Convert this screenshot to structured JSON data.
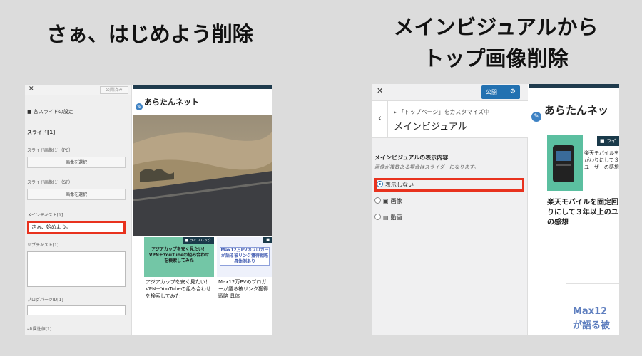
{
  "headings": {
    "left": "さぁ、はじめよう削除",
    "right_line1": "メインビジュアルから",
    "right_line2": "トップ画像削除"
  },
  "left_panel": {
    "close": "✕",
    "published": "公開済み",
    "section_title": "■ 各スライドの設定",
    "slide_heading": "スライド[1]",
    "image_pc_label": "スライド画像[1]（PC）",
    "select_image_button": "画像を選択",
    "image_sp_label": "スライド画像[1]（SP）",
    "select_image_button_2": "画像を選択",
    "main_text_label": "メインテキスト[1]",
    "main_text_value": "さぁ、始めよう。",
    "sub_text_label": "サブテキスト[1]",
    "blog_parts_label": "ブログパーツID[1]",
    "alt_label": "alt属性値[1]"
  },
  "left_preview": {
    "site_title": "あらたんネット",
    "card1_tag": "ライフハック",
    "card1_thumb_text": "アジアカップを安く見たい！VPN＋YouTubeの組み合わせを検索してみた",
    "card1_title": "アジアカップを安く見たい！VPN＋YouTubeの組み合わせを検索してみた",
    "card2_thumb_text": "Max12万PVのブロガーが語る被リンク獲得戦略具体例あり",
    "card2_title": "Max12万PVのブロガーが語る被リンク獲得戦略 具体"
  },
  "right_panel": {
    "close": "✕",
    "publish_button": "公開",
    "breadcrumb": "「トップページ」をカスタマイズ中",
    "section_name": "メインビジュアル",
    "control_title": "メインビジュアルの表示内容",
    "control_desc": "画像が複数ある場合はスライダーになります。",
    "options": [
      {
        "label": "表示しない",
        "selected": true
      },
      {
        "label": "画像",
        "selected": false
      },
      {
        "label": "動画",
        "selected": false
      }
    ]
  },
  "right_preview": {
    "site_title": "あらたんネッ",
    "card_tag": "ライ",
    "desc_line1": "楽天モバイルを",
    "desc_line2": "がわりにして３年",
    "desc_line3": "ユーザーの感想",
    "card_title_line1": "楽天モバイルを固定回",
    "card_title_line2": "りにして３年以上のユ",
    "card_title_line3": "の感想",
    "bottom_text_line1": "Max12",
    "bottom_text_line2": "が語る被"
  },
  "colors": {
    "highlight": "#e8321e",
    "wp_blue": "#2271b1",
    "site_bar": "#1f3b4d"
  }
}
